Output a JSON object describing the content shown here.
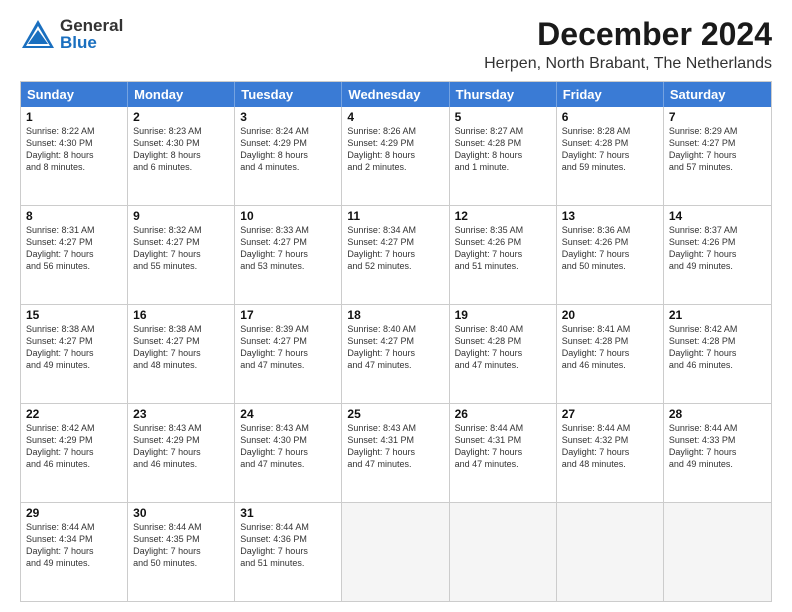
{
  "header": {
    "logo_general": "General",
    "logo_blue": "Blue",
    "main_title": "December 2024",
    "subtitle": "Herpen, North Brabant, The Netherlands"
  },
  "days_of_week": [
    "Sunday",
    "Monday",
    "Tuesday",
    "Wednesday",
    "Thursday",
    "Friday",
    "Saturday"
  ],
  "weeks": [
    [
      {
        "day": "1",
        "rise": "Sunrise: 8:22 AM",
        "set": "Sunset: 4:30 PM",
        "day_text": "Daylight: 8 hours",
        "min_text": "and 8 minutes."
      },
      {
        "day": "2",
        "rise": "Sunrise: 8:23 AM",
        "set": "Sunset: 4:30 PM",
        "day_text": "Daylight: 8 hours",
        "min_text": "and 6 minutes."
      },
      {
        "day": "3",
        "rise": "Sunrise: 8:24 AM",
        "set": "Sunset: 4:29 PM",
        "day_text": "Daylight: 8 hours",
        "min_text": "and 4 minutes."
      },
      {
        "day": "4",
        "rise": "Sunrise: 8:26 AM",
        "set": "Sunset: 4:29 PM",
        "day_text": "Daylight: 8 hours",
        "min_text": "and 2 minutes."
      },
      {
        "day": "5",
        "rise": "Sunrise: 8:27 AM",
        "set": "Sunset: 4:28 PM",
        "day_text": "Daylight: 8 hours",
        "min_text": "and 1 minute."
      },
      {
        "day": "6",
        "rise": "Sunrise: 8:28 AM",
        "set": "Sunset: 4:28 PM",
        "day_text": "Daylight: 7 hours",
        "min_text": "and 59 minutes."
      },
      {
        "day": "7",
        "rise": "Sunrise: 8:29 AM",
        "set": "Sunset: 4:27 PM",
        "day_text": "Daylight: 7 hours",
        "min_text": "and 57 minutes."
      }
    ],
    [
      {
        "day": "8",
        "rise": "Sunrise: 8:31 AM",
        "set": "Sunset: 4:27 PM",
        "day_text": "Daylight: 7 hours",
        "min_text": "and 56 minutes."
      },
      {
        "day": "9",
        "rise": "Sunrise: 8:32 AM",
        "set": "Sunset: 4:27 PM",
        "day_text": "Daylight: 7 hours",
        "min_text": "and 55 minutes."
      },
      {
        "day": "10",
        "rise": "Sunrise: 8:33 AM",
        "set": "Sunset: 4:27 PM",
        "day_text": "Daylight: 7 hours",
        "min_text": "and 53 minutes."
      },
      {
        "day": "11",
        "rise": "Sunrise: 8:34 AM",
        "set": "Sunset: 4:27 PM",
        "day_text": "Daylight: 7 hours",
        "min_text": "and 52 minutes."
      },
      {
        "day": "12",
        "rise": "Sunrise: 8:35 AM",
        "set": "Sunset: 4:26 PM",
        "day_text": "Daylight: 7 hours",
        "min_text": "and 51 minutes."
      },
      {
        "day": "13",
        "rise": "Sunrise: 8:36 AM",
        "set": "Sunset: 4:26 PM",
        "day_text": "Daylight: 7 hours",
        "min_text": "and 50 minutes."
      },
      {
        "day": "14",
        "rise": "Sunrise: 8:37 AM",
        "set": "Sunset: 4:26 PM",
        "day_text": "Daylight: 7 hours",
        "min_text": "and 49 minutes."
      }
    ],
    [
      {
        "day": "15",
        "rise": "Sunrise: 8:38 AM",
        "set": "Sunset: 4:27 PM",
        "day_text": "Daylight: 7 hours",
        "min_text": "and 49 minutes."
      },
      {
        "day": "16",
        "rise": "Sunrise: 8:38 AM",
        "set": "Sunset: 4:27 PM",
        "day_text": "Daylight: 7 hours",
        "min_text": "and 48 minutes."
      },
      {
        "day": "17",
        "rise": "Sunrise: 8:39 AM",
        "set": "Sunset: 4:27 PM",
        "day_text": "Daylight: 7 hours",
        "min_text": "and 47 minutes."
      },
      {
        "day": "18",
        "rise": "Sunrise: 8:40 AM",
        "set": "Sunset: 4:27 PM",
        "day_text": "Daylight: 7 hours",
        "min_text": "and 47 minutes."
      },
      {
        "day": "19",
        "rise": "Sunrise: 8:40 AM",
        "set": "Sunset: 4:28 PM",
        "day_text": "Daylight: 7 hours",
        "min_text": "and 47 minutes."
      },
      {
        "day": "20",
        "rise": "Sunrise: 8:41 AM",
        "set": "Sunset: 4:28 PM",
        "day_text": "Daylight: 7 hours",
        "min_text": "and 46 minutes."
      },
      {
        "day": "21",
        "rise": "Sunrise: 8:42 AM",
        "set": "Sunset: 4:28 PM",
        "day_text": "Daylight: 7 hours",
        "min_text": "and 46 minutes."
      }
    ],
    [
      {
        "day": "22",
        "rise": "Sunrise: 8:42 AM",
        "set": "Sunset: 4:29 PM",
        "day_text": "Daylight: 7 hours",
        "min_text": "and 46 minutes."
      },
      {
        "day": "23",
        "rise": "Sunrise: 8:43 AM",
        "set": "Sunset: 4:29 PM",
        "day_text": "Daylight: 7 hours",
        "min_text": "and 46 minutes."
      },
      {
        "day": "24",
        "rise": "Sunrise: 8:43 AM",
        "set": "Sunset: 4:30 PM",
        "day_text": "Daylight: 7 hours",
        "min_text": "and 47 minutes."
      },
      {
        "day": "25",
        "rise": "Sunrise: 8:43 AM",
        "set": "Sunset: 4:31 PM",
        "day_text": "Daylight: 7 hours",
        "min_text": "and 47 minutes."
      },
      {
        "day": "26",
        "rise": "Sunrise: 8:44 AM",
        "set": "Sunset: 4:31 PM",
        "day_text": "Daylight: 7 hours",
        "min_text": "and 47 minutes."
      },
      {
        "day": "27",
        "rise": "Sunrise: 8:44 AM",
        "set": "Sunset: 4:32 PM",
        "day_text": "Daylight: 7 hours",
        "min_text": "and 48 minutes."
      },
      {
        "day": "28",
        "rise": "Sunrise: 8:44 AM",
        "set": "Sunset: 4:33 PM",
        "day_text": "Daylight: 7 hours",
        "min_text": "and 49 minutes."
      }
    ],
    [
      {
        "day": "29",
        "rise": "Sunrise: 8:44 AM",
        "set": "Sunset: 4:34 PM",
        "day_text": "Daylight: 7 hours",
        "min_text": "and 49 minutes."
      },
      {
        "day": "30",
        "rise": "Sunrise: 8:44 AM",
        "set": "Sunset: 4:35 PM",
        "day_text": "Daylight: 7 hours",
        "min_text": "and 50 minutes."
      },
      {
        "day": "31",
        "rise": "Sunrise: 8:44 AM",
        "set": "Sunset: 4:36 PM",
        "day_text": "Daylight: 7 hours",
        "min_text": "and 51 minutes."
      },
      null,
      null,
      null,
      null
    ]
  ]
}
